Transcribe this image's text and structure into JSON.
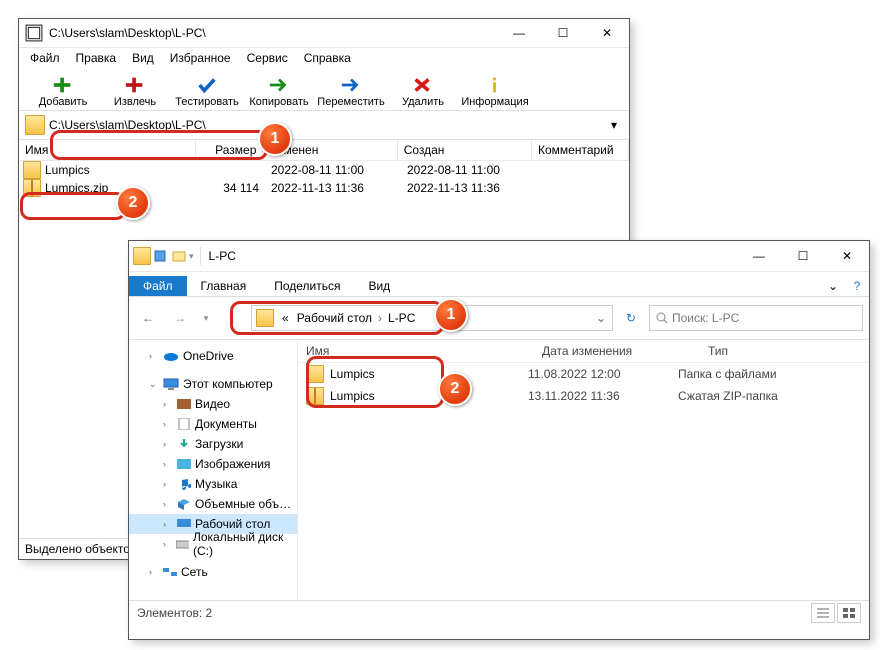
{
  "sevenzip": {
    "title": "C:\\Users\\slam\\Desktop\\L-PC\\",
    "menu": [
      "Файл",
      "Правка",
      "Вид",
      "Избранное",
      "Сервис",
      "Справка"
    ],
    "toolbar": [
      {
        "label": "Добавить"
      },
      {
        "label": "Извлечь"
      },
      {
        "label": "Тестировать"
      },
      {
        "label": "Копировать"
      },
      {
        "label": "Переместить"
      },
      {
        "label": "Удалить"
      },
      {
        "label": "Информация"
      }
    ],
    "path": "C:\\Users\\slam\\Desktop\\L-PC\\",
    "columns": {
      "name": "Имя",
      "size": "Размер",
      "modified": "Изменен",
      "created": "Создан",
      "comment": "Комментарий"
    },
    "rows": [
      {
        "name": "Lumpics",
        "size": "",
        "modified": "2022-08-11 11:00",
        "created": "2022-08-11 11:00",
        "icon": "folder"
      },
      {
        "name": "Lumpics.zip",
        "size": "34 114",
        "modified": "2022-11-13 11:36",
        "created": "2022-11-13 11:36",
        "icon": "zip"
      }
    ],
    "status": "Выделено объектов"
  },
  "explorer": {
    "title": "L-PC",
    "ribbon": {
      "file": "Файл",
      "tabs": [
        "Главная",
        "Поделиться",
        "Вид"
      ]
    },
    "breadcrumb": {
      "prefix": "«",
      "items": [
        "Рабочий стол",
        "L-PC"
      ]
    },
    "search_placeholder": "Поиск: L-PC",
    "columns": {
      "name": "Имя",
      "date": "Дата изменения",
      "type": "Тип"
    },
    "rows": [
      {
        "name": "Lumpics",
        "date": "11.08.2022 12:00",
        "type": "Папка с файлами",
        "icon": "folder"
      },
      {
        "name": "Lumpics",
        "date": "13.11.2022 11:36",
        "type": "Сжатая ZIP-папка",
        "icon": "zip"
      }
    ],
    "tree": [
      {
        "label": "OneDrive",
        "lvl": 1,
        "icon": "cloud"
      },
      {
        "label": "Этот компьютер",
        "lvl": 1,
        "icon": "pc",
        "exp": true
      },
      {
        "label": "Видео",
        "lvl": 2,
        "icon": "vid"
      },
      {
        "label": "Документы",
        "lvl": 2,
        "icon": "doc"
      },
      {
        "label": "Загрузки",
        "lvl": 2,
        "icon": "dl"
      },
      {
        "label": "Изображения",
        "lvl": 2,
        "icon": "img"
      },
      {
        "label": "Музыка",
        "lvl": 2,
        "icon": "mus"
      },
      {
        "label": "Объемные объ…",
        "lvl": 2,
        "icon": "obj"
      },
      {
        "label": "Рабочий стол",
        "lvl": 2,
        "icon": "desk",
        "sel": true
      },
      {
        "label": "Локальный диск (C:)",
        "lvl": 2,
        "icon": "disk"
      },
      {
        "label": "Сеть",
        "lvl": 1,
        "icon": "net"
      }
    ],
    "status": "Элементов: 2"
  },
  "annotations": {
    "b1": "1",
    "b2": "2"
  }
}
